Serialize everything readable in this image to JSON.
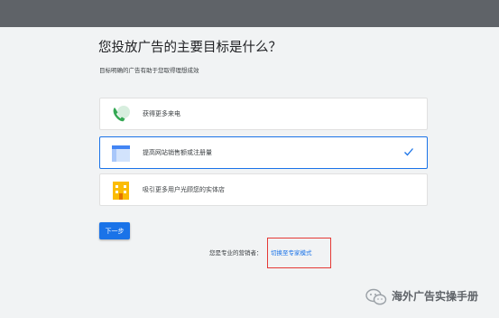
{
  "page": {
    "title": "您投放广告的主要目标是什么？",
    "subtitle": "目标明确的广告有助于您取得理想成效"
  },
  "options": [
    {
      "label": "获得更多来电",
      "icon": "phone-icon",
      "selected": false
    },
    {
      "label": "提高网站销售额或注册量",
      "icon": "website-icon",
      "selected": true
    },
    {
      "label": "吸引更多用户光顾您的实体店",
      "icon": "storefront-icon",
      "selected": false
    }
  ],
  "actions": {
    "next_label": "下一步",
    "expert_question": "您是专业的营销者：",
    "expert_link": "切换至专家模式"
  },
  "watermark": {
    "text": "海外广告实操手册",
    "icon": "wechat-icon"
  },
  "colors": {
    "accent": "#1a73e8",
    "highlight": "#e53935",
    "topbar": "#5f6368",
    "background": "#f1f3f4"
  }
}
